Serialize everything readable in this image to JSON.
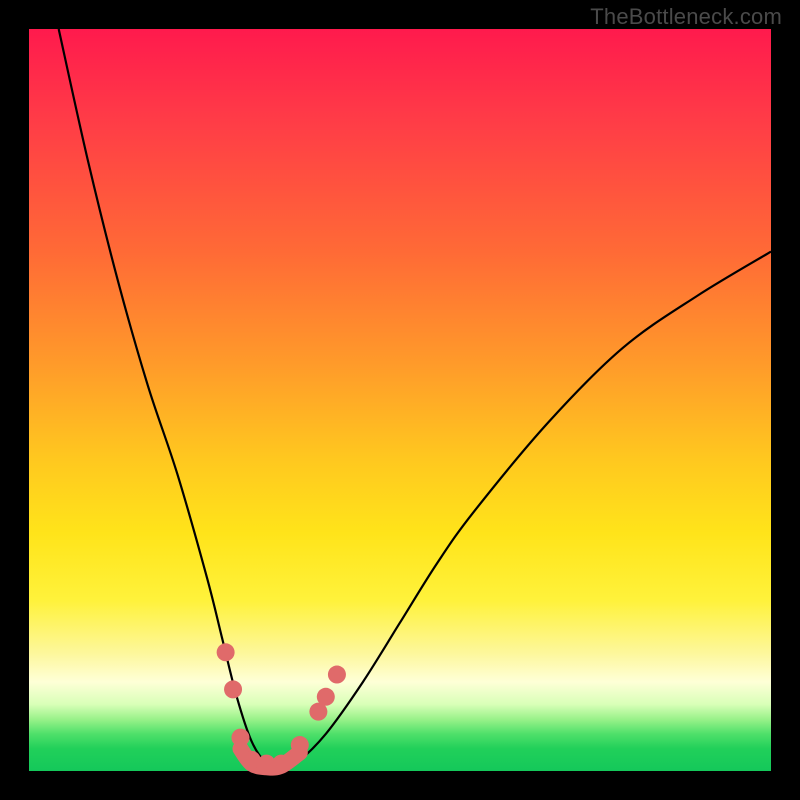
{
  "watermark": "TheBottleneck.com",
  "chart_data": {
    "type": "line",
    "title": "",
    "xlabel": "",
    "ylabel": "",
    "xlim": [
      0,
      100
    ],
    "ylim": [
      0,
      100
    ],
    "grid": false,
    "legend": false,
    "background_gradient_stops": [
      {
        "pos": 0,
        "color": "#ff1a4d"
      },
      {
        "pos": 30,
        "color": "#ff6a36"
      },
      {
        "pos": 58,
        "color": "#ffc81f"
      },
      {
        "pos": 77,
        "color": "#fff23b"
      },
      {
        "pos": 88,
        "color": "#feffd7"
      },
      {
        "pos": 95,
        "color": "#4fe06a"
      },
      {
        "pos": 100,
        "color": "#14c85a"
      }
    ],
    "series": [
      {
        "name": "bottleneck-curve",
        "color": "#000000",
        "x": [
          4,
          8,
          12,
          16,
          20,
          24,
          26,
          28,
          30,
          32,
          34,
          36,
          40,
          45,
          50,
          55,
          60,
          70,
          80,
          90,
          100
        ],
        "y": [
          100,
          82,
          66,
          52,
          40,
          26,
          18,
          10,
          4,
          1,
          0,
          1,
          5,
          12,
          20,
          28,
          35,
          47,
          57,
          64,
          70
        ]
      }
    ],
    "markers": {
      "name": "highlighted-points",
      "color": "#e06a6a",
      "points": [
        {
          "x": 26.5,
          "y": 16
        },
        {
          "x": 27.5,
          "y": 11
        },
        {
          "x": 28.5,
          "y": 4.5
        },
        {
          "x": 30,
          "y": 1.5
        },
        {
          "x": 32,
          "y": 1
        },
        {
          "x": 34,
          "y": 1
        },
        {
          "x": 36.5,
          "y": 3.5
        },
        {
          "x": 39,
          "y": 8
        },
        {
          "x": 40,
          "y": 10
        },
        {
          "x": 41.5,
          "y": 13
        }
      ]
    },
    "bottom_band": {
      "name": "valley-connector",
      "color": "#e06a6a",
      "x": [
        28.5,
        30,
        32,
        34,
        36.5
      ],
      "y": [
        3,
        1,
        0.5,
        0.7,
        2.5
      ]
    }
  }
}
